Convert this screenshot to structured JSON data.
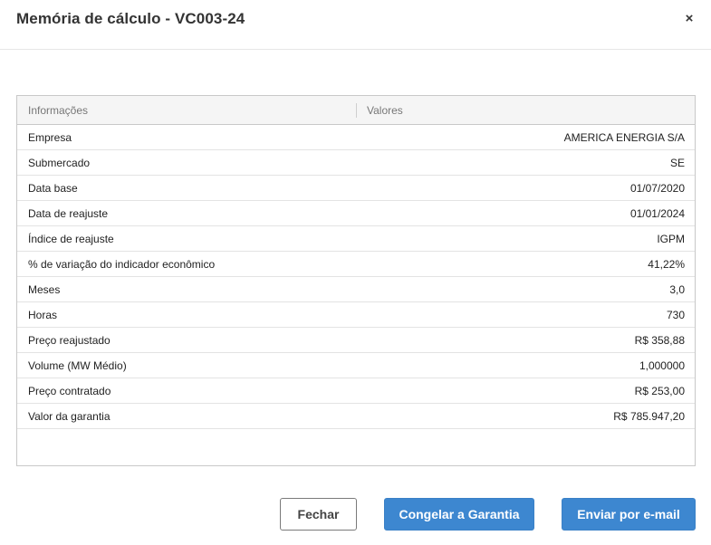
{
  "dialog": {
    "title": "Memória de cálculo - VC003-24",
    "close_symbol": "×"
  },
  "grid": {
    "columns": [
      "Informações",
      "Valores"
    ],
    "rows": [
      {
        "label": "Empresa",
        "value": "AMERICA ENERGIA S/A"
      },
      {
        "label": "Submercado",
        "value": "SE"
      },
      {
        "label": "Data base",
        "value": "01/07/2020"
      },
      {
        "label": "Data de reajuste",
        "value": "01/01/2024"
      },
      {
        "label": "Índice de reajuste",
        "value": "IGPM"
      },
      {
        "label": "% de variação do indicador econômico",
        "value": "41,22%"
      },
      {
        "label": "Meses",
        "value": "3,0"
      },
      {
        "label": "Horas",
        "value": "730"
      },
      {
        "label": "Preço reajustado",
        "value": "R$ 358,88"
      },
      {
        "label": "Volume (MW Médio)",
        "value": "1,000000"
      },
      {
        "label": "Preço contratado",
        "value": "R$ 253,00"
      },
      {
        "label": "Valor da garantia",
        "value": "R$ 785.947,20"
      }
    ]
  },
  "footer": {
    "close_label": "Fechar",
    "freeze_label": "Congelar a Garantia",
    "email_label": "Enviar por e-mail"
  },
  "colors": {
    "primary": "#3d87d0",
    "header_bg": "#f5f5f5",
    "border": "#c8c8c8"
  }
}
